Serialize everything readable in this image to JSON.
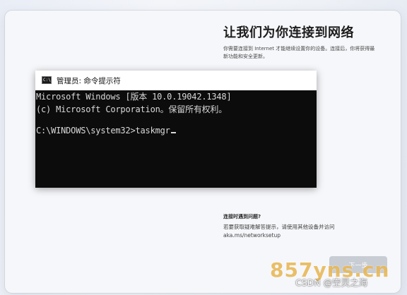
{
  "oobe": {
    "title": "让我们为你连接到网络",
    "description": "你需要连接到 Internet 才能继续设置你的设备。连接后，你将获得最新功能和安全更新。",
    "help_title": "连接时遇到问题?",
    "help_text": "若要获取疑难解答提示，请使用其他设备并访问 aka.ms/networksetup",
    "next_button_label": "下一步"
  },
  "cmd": {
    "icon_text": "C:\\",
    "title": "管理员: 命令提示符",
    "lines": [
      "Microsoft Windows [版本 10.0.19042.1348]",
      "(c) Microsoft Corporation。保留所有权利。",
      "",
      "C:\\WINDOWS\\system32>taskmgr"
    ]
  },
  "watermark": {
    "site": "857yns.cn",
    "csdn": "CSDN @空灵之海"
  },
  "colors": {
    "console_bg": "#0c0c0c",
    "console_text": "#d9d9d9",
    "button_disabled": "#c8ccd3"
  }
}
